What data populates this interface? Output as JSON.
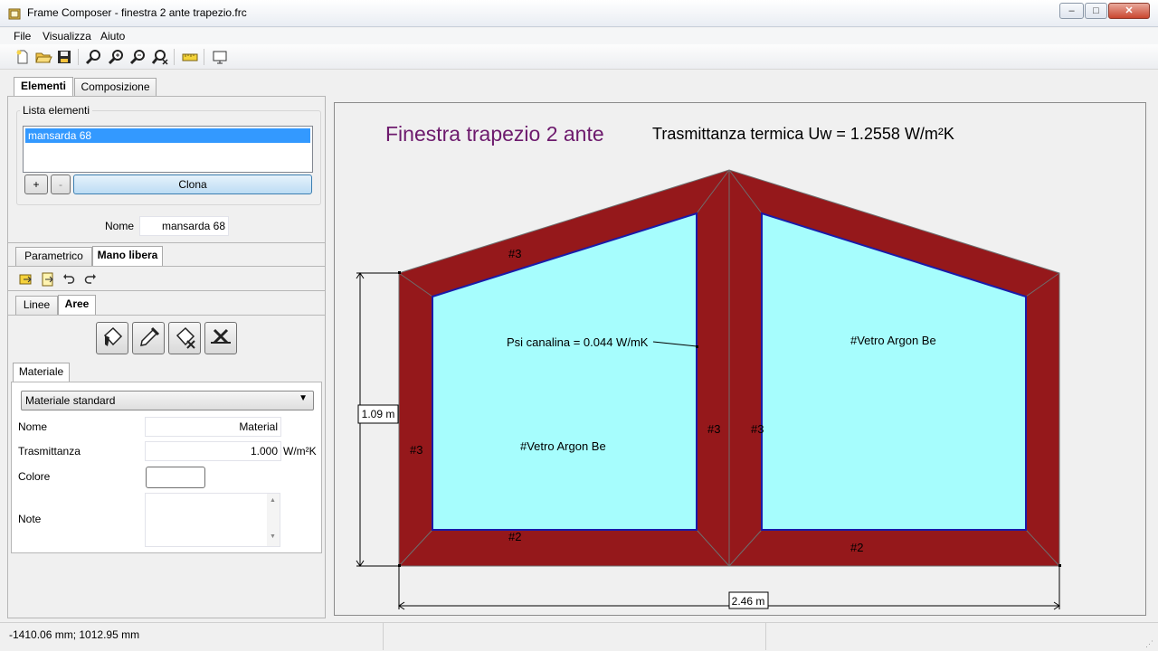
{
  "window": {
    "title": "Frame Composer - finestra 2 ante trapezio.frc"
  },
  "menu": {
    "items": [
      "File",
      "Visualizza",
      "Aiuto"
    ]
  },
  "toolbar": {
    "icons": [
      "new-file-icon",
      "open-folder-icon",
      "save-icon",
      "zoom-fit-icon",
      "zoom-in-icon",
      "zoom-out-icon",
      "zoom-reset-icon",
      "measure-ruler-icon",
      "screen-icon"
    ]
  },
  "main_tabs": [
    "Elementi",
    "Composizione"
  ],
  "elements": {
    "group_label": "Lista elementi",
    "items": [
      "mansarda 68"
    ],
    "add_label": "+",
    "remove_label": "-",
    "clone_label": "Clona",
    "name_label": "Nome",
    "name_value": "mansarda 68"
  },
  "mode_tabs": [
    "Parametrico",
    "Mano libera"
  ],
  "sub_tabs": [
    "Linee",
    "Aree"
  ],
  "material": {
    "tab_label": "Materiale",
    "dropdown_value": "Materiale standard",
    "name_label": "Nome",
    "name_value": "Material",
    "trans_label": "Trasmittanza",
    "trans_value": "1.000",
    "trans_unit": "W/m²K",
    "color_label": "Colore",
    "note_label": "Note"
  },
  "drawing": {
    "title": "Finestra trapezio 2 ante",
    "uw_text": "Trasmittanza termica Uw = 1.2558 W/m²K",
    "psi_label": "Psi canalina = 0.044 W/mK",
    "glass_left": "#Vetro Argon Be",
    "glass_right": "#Vetro Argon Be",
    "labels": [
      "#3",
      "#3",
      "#3",
      "#3",
      "#2",
      "#2"
    ],
    "dim_height": "1.09 m",
    "dim_width": "2.46 m",
    "colors": {
      "frame": "#95181b",
      "glass": "#a6fdfd",
      "title": "#6d1a6d",
      "glass_border": "#1a1aa8"
    }
  },
  "status": {
    "coords": "-1410.06 mm; 1012.95 mm"
  }
}
